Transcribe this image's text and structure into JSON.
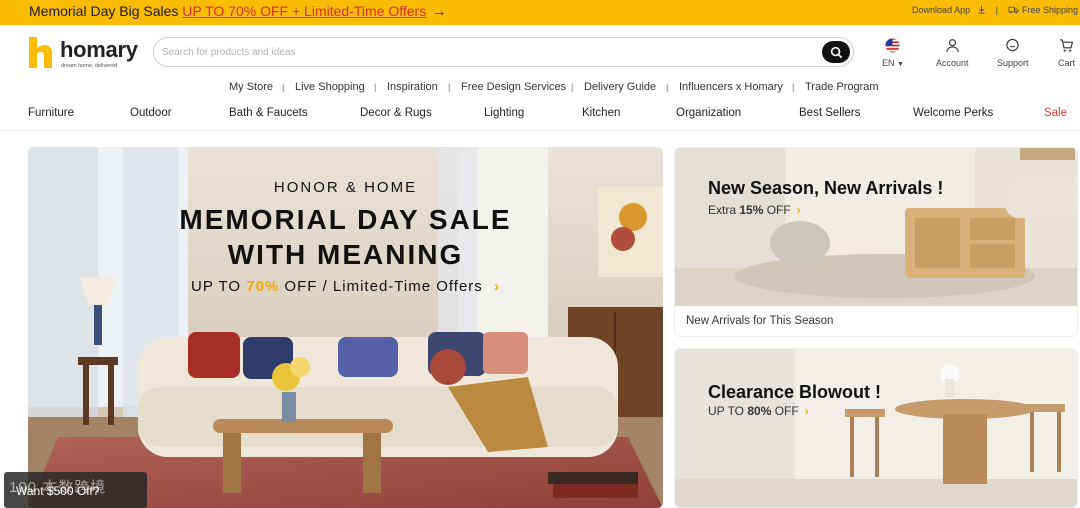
{
  "topbar": {
    "promo_text": "Memorial Day Big Sales ",
    "promo_link": "UP TO 70% OFF + Limited-Time Offers",
    "promo_arrow": "→",
    "download_app": "Download App",
    "divider": "|",
    "free_shipping": "Free Shipping"
  },
  "brand": {
    "name": "homary",
    "tagline": "dream home, delivered",
    "accent": "#fbbc05"
  },
  "search": {
    "placeholder": "Search for products and ideas",
    "value": ""
  },
  "header_icons": {
    "language": "EN",
    "account": "Account",
    "support": "Support",
    "cart": "Cart"
  },
  "subnav": [
    "My Store",
    "Live Shopping",
    "Inspiration",
    "Free Design Services",
    "Delivery Guide",
    "Influencers x Homary",
    "Trade Program"
  ],
  "subnav_sep": "|",
  "categories": [
    "Furniture",
    "Outdoor",
    "Bath & Faucets",
    "Decor & Rugs",
    "Lighting",
    "Kitchen",
    "Organization",
    "Best Sellers",
    "Welcome Perks",
    "Sale"
  ],
  "hero": {
    "kicker": "HONOR & HOME",
    "line1": "MEMORIAL DAY SALE",
    "line2": "WITH MEANING",
    "sub_pre": "UP TO ",
    "sub_highlight": "70%",
    "sub_post": " OFF / Limited-Time Offers",
    "sub_chevron": "›"
  },
  "card_new": {
    "title": "New Season, New Arrivals !",
    "offer_pre": "Extra ",
    "offer_bold": "15%",
    "offer_post": " OFF",
    "chevron": "›",
    "caption": "New Arrivals for This Season"
  },
  "card_clearance": {
    "title": "Clearance Blowout !",
    "offer_pre": "UP TO ",
    "offer_bold": "80%",
    "offer_post": " OFF",
    "chevron": "›"
  },
  "chat": {
    "watermark": "100 本数跨境",
    "message": "Want $500 Off?"
  },
  "colors": {
    "topbar": "#fbbc05",
    "sale": "#e53935",
    "promo_link": "#d32f2f",
    "highlight": "#f2a900"
  }
}
